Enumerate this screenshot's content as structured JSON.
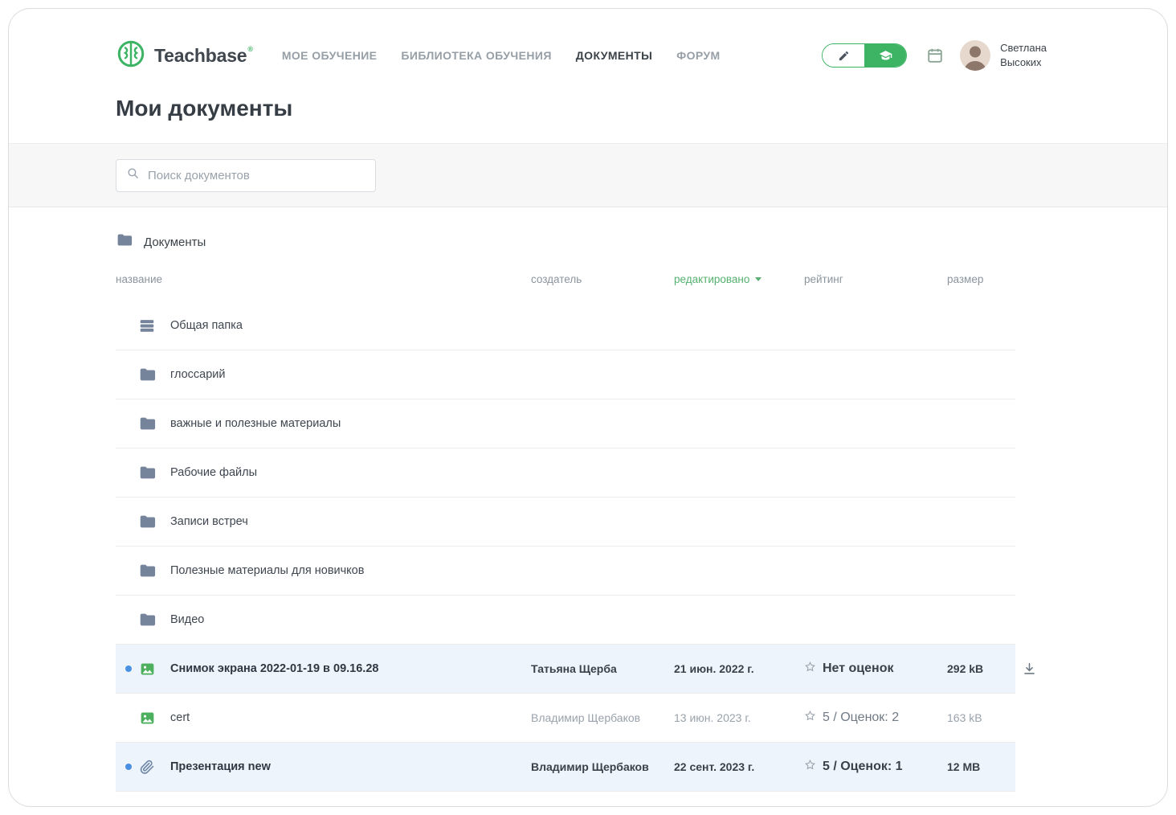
{
  "header": {
    "brand": {
      "name": "Teachbase",
      "mark": "®"
    },
    "nav": [
      {
        "label": "МОЕ ОБУЧЕНИЕ"
      },
      {
        "label": "БИБЛИОТЕКА ОБУЧЕНИЯ"
      },
      {
        "label": "ДОКУМЕНТЫ"
      },
      {
        "label": "ФОРУМ"
      }
    ],
    "user": {
      "first_name": "Светлана",
      "last_name": "Высоких"
    }
  },
  "page": {
    "title": "Мои документы"
  },
  "search": {
    "placeholder": "Поиск документов"
  },
  "table": {
    "section_title": "Документы",
    "columns": {
      "name": "название",
      "creator": "создатель",
      "edited": "редактировано",
      "rating": "рейтинг",
      "size": "размер"
    },
    "rows": [
      {
        "type": "shared-folder",
        "name": "Общая папка"
      },
      {
        "type": "folder",
        "name": "глоссарий"
      },
      {
        "type": "folder",
        "name": "важные и полезные материалы"
      },
      {
        "type": "folder",
        "name": "Рабочие файлы"
      },
      {
        "type": "folder",
        "name": "Записи встреч"
      },
      {
        "type": "folder",
        "name": "Полезные материалы для новичков"
      },
      {
        "type": "folder",
        "name": "Видео"
      },
      {
        "type": "image-file",
        "name": "Снимок экрана 2022-01-19 в 09.16.28",
        "creator": "Татьяна Щерба",
        "edited": "21 июн. 2022 г.",
        "rating": "Нет оценок",
        "size": "292 kB",
        "unread": true
      },
      {
        "type": "image-file",
        "name": "cert",
        "creator": "Владимир Щербаков",
        "edited": "13 июн. 2023 г.",
        "rating": "5 / Оценок: 2",
        "size": "163 kB",
        "unread": false
      },
      {
        "type": "attachment",
        "name": "Презентация new",
        "creator": "Владимир Щербаков",
        "edited": "22 сент. 2023 г.",
        "rating": "5 / Оценок: 1",
        "size": "12 MB",
        "unread": true
      }
    ]
  },
  "colors": {
    "brand_green": "#3CB464",
    "edited_sort_green": "#55B16F",
    "unread_dot_blue": "#4A90E2",
    "row_highlight": "#EEF4FC"
  }
}
